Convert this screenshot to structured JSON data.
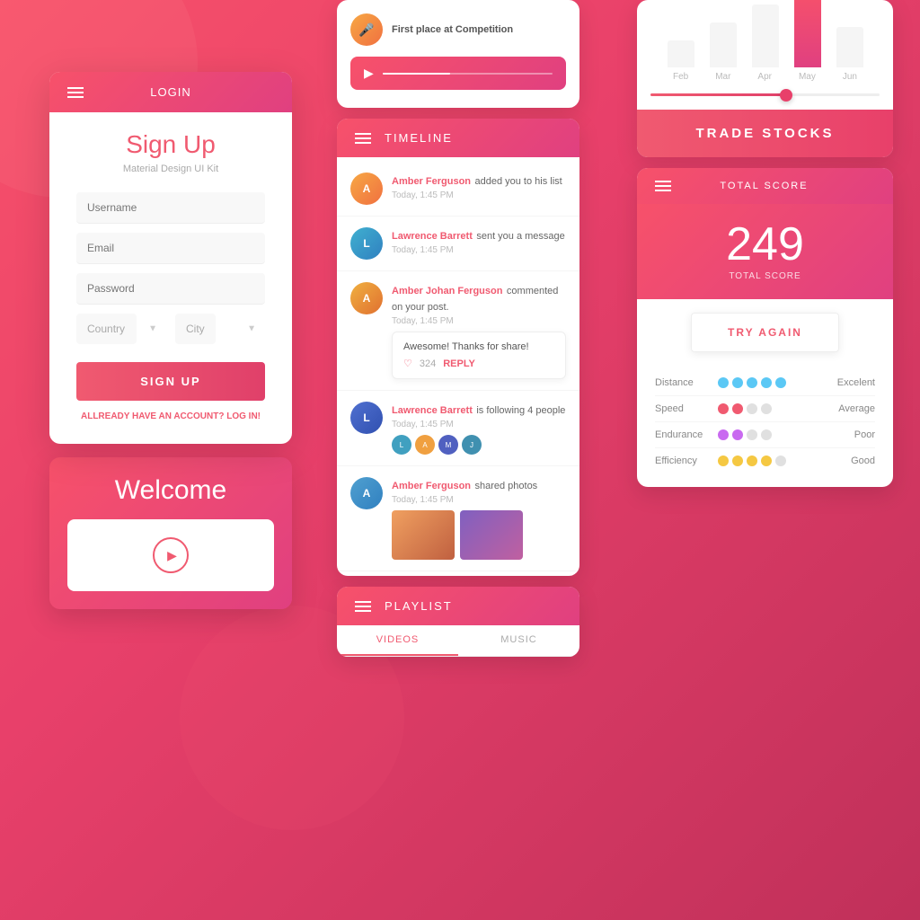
{
  "background": {
    "gradient_start": "#f7516a",
    "gradient_end": "#c0305a"
  },
  "left_col": {
    "login_bar": {
      "menu_label": "menu",
      "title": "LOGIN"
    },
    "signup": {
      "heading": "Sign Up",
      "subtitle": "Material Design UI Kit",
      "username_placeholder": "Username",
      "email_placeholder": "Email",
      "password_placeholder": "Password",
      "country_placeholder": "Country",
      "city_placeholder": "City",
      "button_label": "SIGN UP",
      "already_account": "ALLREADY HAVE AN ACCOUNT?",
      "login_link": "LOG IN!"
    },
    "welcome": {
      "heading": "Welcome"
    }
  },
  "middle_col": {
    "music_card": {
      "avatar_char": "🎵",
      "title": "First place at Competition",
      "subtitle": ""
    },
    "timeline": {
      "title": "TIMELINE",
      "items": [
        {
          "name": "Amber Ferguson",
          "action": " added you to his list",
          "time": "Today, 1:45 PM",
          "avatar_char": "A",
          "avatar_color": "#f07040"
        },
        {
          "name": "Lawrence Barrett",
          "action": " sent you a message",
          "time": "Today, 1:45 PM",
          "avatar_char": "L",
          "avatar_color": "#40a0c0"
        },
        {
          "name": "Amber Johan Ferguson",
          "action": " commented on your post.",
          "time": "Today, 1:45 PM",
          "avatar_char": "A",
          "avatar_color": "#f0a040",
          "comment": "Awesome! Thanks for share!",
          "likes": "324",
          "reply": "REPLY"
        },
        {
          "name": "Lawrence Barrett",
          "action": " is following 4 people",
          "time": "Today, 1:45 PM",
          "avatar_char": "L",
          "avatar_color": "#4060c0"
        },
        {
          "name": "Amber Ferguson",
          "action": " shared photos",
          "time": "Today, 1:45 PM",
          "avatar_char": "A",
          "avatar_color": "#5090c0"
        }
      ]
    },
    "playlist": {
      "title": "PLAYLIST",
      "tabs": [
        "VIDEOS",
        "MUSIC"
      ]
    }
  },
  "right_col": {
    "chart": {
      "months": [
        "Feb",
        "Mar",
        "Apr",
        "May",
        "Jun"
      ],
      "bars": [
        30,
        50,
        70,
        85,
        45
      ],
      "active_bar": 3
    },
    "trade_button": "TRADE STOCKS",
    "score": {
      "header_label": "TOTAL SCORE",
      "number": "249",
      "sub_label": "TOTAL SCORE",
      "try_again": "TRY AGAIN",
      "metrics": [
        {
          "name": "Distance",
          "filled": 5,
          "total": 5,
          "color": "blue",
          "rating": "Excelent"
        },
        {
          "name": "Speed",
          "filled": 2,
          "total": 4,
          "color": "red",
          "rating": "Average"
        },
        {
          "name": "Endurance",
          "filled": 2,
          "total": 4,
          "color": "purple",
          "rating": "Poor"
        },
        {
          "name": "Efficiency",
          "filled": 4,
          "total": 5,
          "color": "yellow",
          "rating": "Good"
        }
      ]
    }
  }
}
